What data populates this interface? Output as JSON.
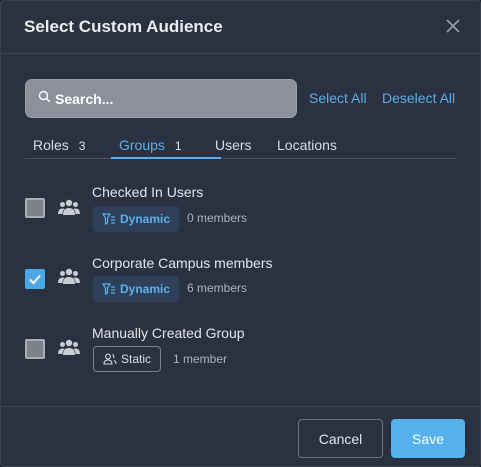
{
  "dialog": {
    "title": "Select Custom Audience",
    "close_icon": "close-icon"
  },
  "search": {
    "placeholder": "Search...",
    "value": "",
    "icon": "search-icon"
  },
  "actions": {
    "select_all": "Select All",
    "deselect_all": "Deselect All"
  },
  "tabs": [
    {
      "label": "Roles",
      "count": "3",
      "active": false
    },
    {
      "label": "Groups",
      "count": "1",
      "active": true
    },
    {
      "label": "Users",
      "count": "",
      "active": false
    },
    {
      "label": "Locations",
      "count": "",
      "active": false
    }
  ],
  "groups": [
    {
      "name": "Checked In Users",
      "type": "Dynamic",
      "members": "0 members",
      "checked": false,
      "icon": "group-icon"
    },
    {
      "name": "Corporate Campus members",
      "type": "Dynamic",
      "members": "6 members",
      "checked": true,
      "icon": "group-icon"
    },
    {
      "name": "Manually Created Group",
      "type": "Static",
      "members": "1 member",
      "checked": false,
      "icon": "group-icon"
    }
  ],
  "footer": {
    "cancel_label": "Cancel",
    "save_label": "Save"
  },
  "colors": {
    "accent": "#56b1ea",
    "background": "#2a3140",
    "dynamic_badge_bg": "#30405a"
  }
}
